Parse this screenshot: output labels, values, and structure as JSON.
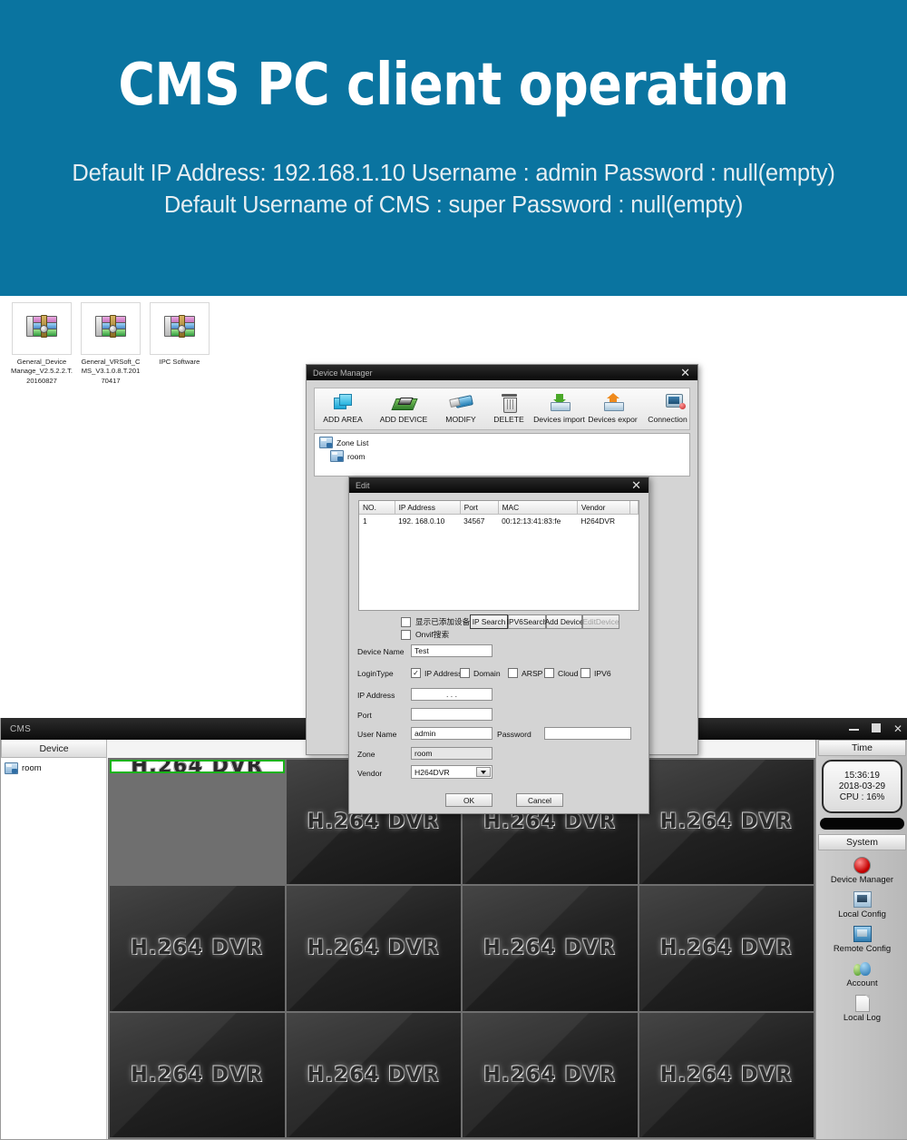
{
  "banner": {
    "title": "CMS PC client operation",
    "line1": "Default IP Address: 192.168.1.10 Username : admin Password : null(empty)",
    "line2": "Default Username of CMS : super Password : null(empty)",
    "bg_color": "#0a74a0"
  },
  "desktop": {
    "icons": [
      {
        "label": "General_Device Manage_V2.5.2.2.T.20160827",
        "icon": "winrar-archive-icon"
      },
      {
        "label": "General_VRSoft_CMS_V3.1.0.8.T.20170417",
        "icon": "winrar-archive-icon"
      },
      {
        "label": "IPC Software",
        "icon": "winrar-archive-icon"
      }
    ]
  },
  "cms": {
    "title": "CMS",
    "window_buttons": [
      "minimize",
      "maximize",
      "close"
    ],
    "device_panel": {
      "header": "Device",
      "tree": [
        {
          "label": "room"
        }
      ]
    },
    "wall": {
      "tile_label": "H.264 DVR",
      "rows": 3,
      "cols": 4,
      "selected_index": 0,
      "selection_color": "#19b319"
    },
    "right_panel": {
      "time_header": "Time",
      "clock": {
        "time": "15:36:19",
        "date": "2018-03-29",
        "cpu": "CPU : 16%"
      },
      "system_header": "System",
      "system_items": [
        {
          "label": "Device Manager",
          "icon": "red-button-icon"
        },
        {
          "label": "Local Config",
          "icon": "local-config-icon"
        },
        {
          "label": "Remote Config",
          "icon": "remote-config-icon"
        },
        {
          "label": "Account",
          "icon": "users-icon"
        },
        {
          "label": "Local Log",
          "icon": "document-icon"
        }
      ]
    }
  },
  "device_manager": {
    "title": "Device Manager",
    "close_label": "✕",
    "toolbar": [
      {
        "label": "ADD AREA",
        "icon": "add-area-icon"
      },
      {
        "label": "ADD DEVICE",
        "icon": "add-device-icon"
      },
      {
        "label": "MODIFY",
        "icon": "modify-usb-icon"
      },
      {
        "label": "DELETE",
        "icon": "trash-icon"
      },
      {
        "label": "Devices import",
        "icon": "import-icon"
      },
      {
        "label": "Devices expor",
        "icon": "export-icon"
      },
      {
        "label": "Connection Test",
        "icon": "connection-test-icon"
      }
    ],
    "tree": [
      {
        "label": "Zone List",
        "level": 1
      },
      {
        "label": "room",
        "level": 2
      }
    ]
  },
  "edit_dialog": {
    "title": "Edit",
    "close_label": "✕",
    "grid": {
      "columns": [
        "NO.",
        "IP Address",
        "Port",
        "MAC",
        "Vendor",
        ""
      ],
      "rows": [
        {
          "no": "1",
          "ip": "192. 168.0.10",
          "port": "34567",
          "mac": "00:12:13:41:83:fe",
          "vendor": "H264DVR",
          "extra": ""
        }
      ]
    },
    "checkbox_show_added": "显示已添加设备",
    "checkbox_onvif": "Onvif搜索",
    "buttons": {
      "ip_search": "IP Search",
      "ipv6_search": "IPV6Search",
      "add_device": "Add Device",
      "edit_device": "EditDevice",
      "ok": "OK",
      "cancel": "Cancel"
    },
    "fields": {
      "device_name_label": "Device Name",
      "device_name_value": "Test",
      "login_type_label": "LoginType",
      "login_types": [
        {
          "label": "IP Address",
          "checked": true
        },
        {
          "label": "Domain",
          "checked": false
        },
        {
          "label": "ARSP",
          "checked": false
        },
        {
          "label": "Cloud",
          "checked": false
        },
        {
          "label": "IPV6",
          "checked": false
        }
      ],
      "ip_address_label": "IP Address",
      "ip_address_value": ".   .   .",
      "port_label": "Port",
      "port_value": "",
      "user_name_label": "User Name",
      "user_name_value": "admin",
      "password_label": "Password",
      "password_value": "",
      "zone_label": "Zone",
      "zone_value": "room",
      "vendor_label": "Vendor",
      "vendor_value": "H264DVR"
    }
  }
}
